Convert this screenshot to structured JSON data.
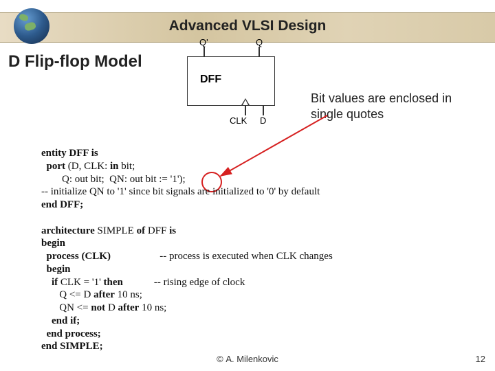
{
  "header": {
    "title": "Advanced VLSI Design"
  },
  "main": {
    "title": "D Flip-flop Model",
    "note": "Bit values are enclosed in single quotes"
  },
  "dff": {
    "box_label": "DFF",
    "pins": {
      "q_bar": "Q'",
      "q": "Q",
      "clk": "CLK",
      "d": "D"
    }
  },
  "code": {
    "l1": "entity DFF is",
    "l2": "  port (D, CLK: in bit;",
    "l3a": "        Q: out bit;  QN: out bit := ",
    "l3b": "'1'",
    "l3c": ");",
    "l4": "-- initialize QN to '1' since bit signals are initialized to '0' by default",
    "l5": "end DFF;",
    "l6": "",
    "l7": "architecture SIMPLE of DFF is",
    "l8": "begin",
    "l9a": "  process (CLK)",
    "l9b": "                   -- process is executed when CLK changes",
    "l10": "  begin",
    "l11a": "    if CLK = '1' then",
    "l11b": "            -- rising edge of clock",
    "l12": "       Q <= D after 10 ns;",
    "l13": "       QN <= not D after 10 ns;",
    "l14": "    end if;",
    "l15": "  end process;",
    "l16": "end SIMPLE;"
  },
  "footer": {
    "author": "A. Milenkovic",
    "page": "12",
    "copyright": "©"
  }
}
